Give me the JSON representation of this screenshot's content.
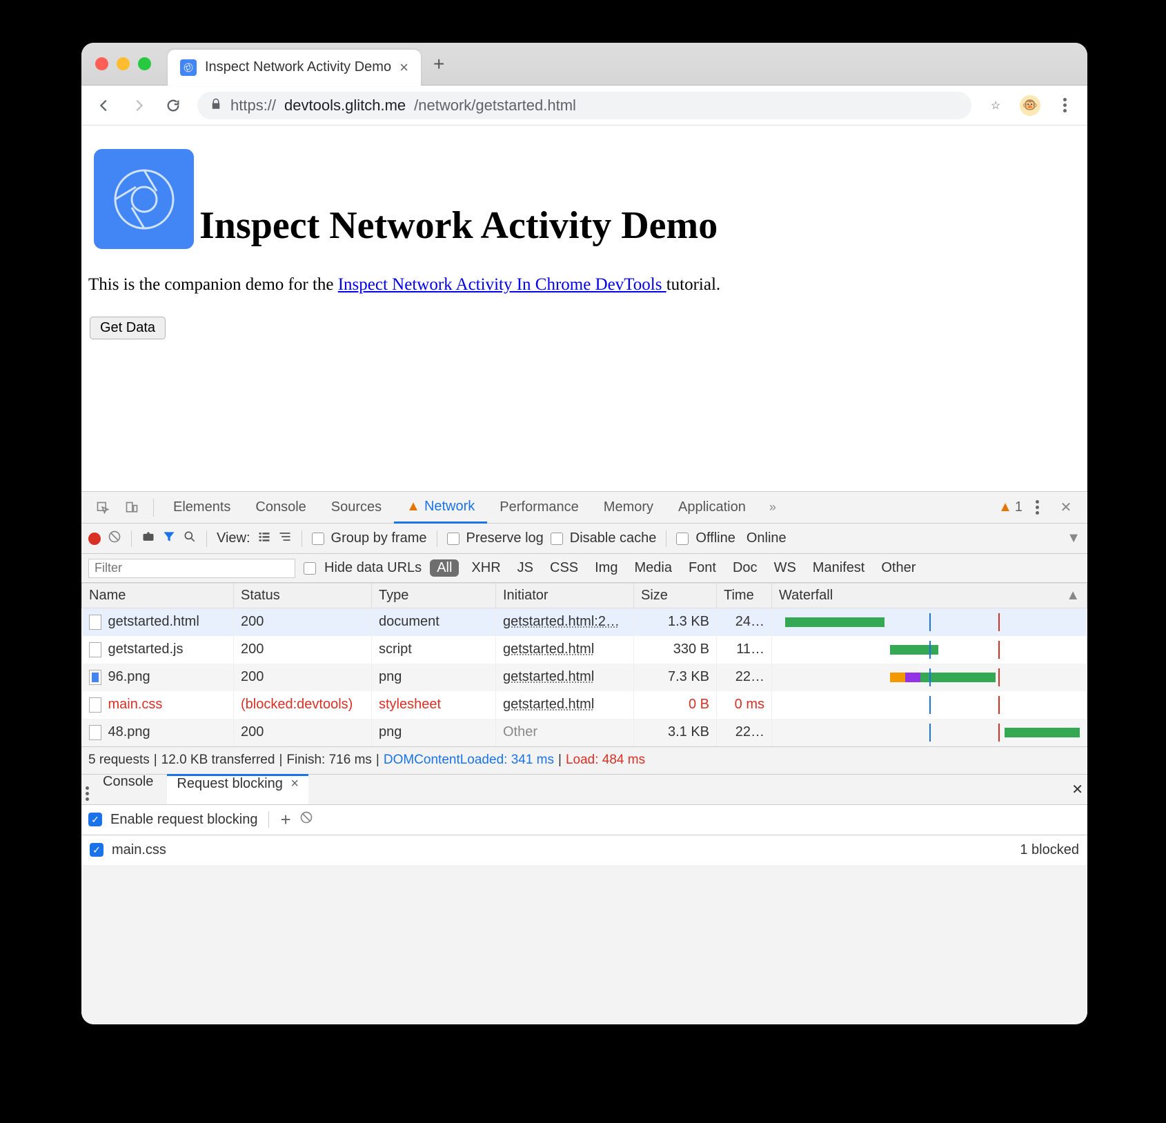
{
  "browser": {
    "tab_title": "Inspect Network Activity Demo",
    "url_display_scheme": "https://",
    "url_display_host": "devtools.glitch.me",
    "url_display_path": "/network/getstarted.html"
  },
  "page": {
    "heading": "Inspect Network Activity Demo",
    "intro_pre": "This is the companion demo for the ",
    "intro_link": "Inspect Network Activity In Chrome DevTools ",
    "intro_post": "tutorial.",
    "button": "Get Data"
  },
  "devtools": {
    "tabs": [
      "Elements",
      "Console",
      "Sources",
      "Network",
      "Performance",
      "Memory",
      "Application"
    ],
    "active_tab": "Network",
    "warning_count": "1",
    "toolbar": {
      "view_label": "View:",
      "group_by_frame": "Group by frame",
      "preserve_log": "Preserve log",
      "disable_cache": "Disable cache",
      "offline": "Offline",
      "online": "Online"
    },
    "filter": {
      "placeholder": "Filter",
      "hide_data_urls": "Hide data URLs",
      "types": [
        "All",
        "XHR",
        "JS",
        "CSS",
        "Img",
        "Media",
        "Font",
        "Doc",
        "WS",
        "Manifest",
        "Other"
      ]
    },
    "columns": [
      "Name",
      "Status",
      "Type",
      "Initiator",
      "Size",
      "Time",
      "Waterfall"
    ],
    "rows": [
      {
        "name": "getstarted.html",
        "status": "200",
        "type": "document",
        "initiator": "getstarted.html:2…",
        "size": "1.3 KB",
        "time": "24…",
        "blocked": false,
        "selected": true,
        "icon": "doc"
      },
      {
        "name": "getstarted.js",
        "status": "200",
        "type": "script",
        "initiator": "getstarted.html",
        "size": "330 B",
        "time": "11…",
        "blocked": false,
        "selected": false,
        "icon": "doc"
      },
      {
        "name": "96.png",
        "status": "200",
        "type": "png",
        "initiator": "getstarted.html",
        "size": "7.3 KB",
        "time": "22…",
        "blocked": false,
        "selected": false,
        "icon": "img"
      },
      {
        "name": "main.css",
        "status": "(blocked:devtools)",
        "type": "stylesheet",
        "initiator": "getstarted.html",
        "size": "0 B",
        "time": "0 ms",
        "blocked": true,
        "selected": false,
        "icon": "doc"
      },
      {
        "name": "48.png",
        "status": "200",
        "type": "png",
        "initiator": "Other",
        "size": "3.1 KB",
        "time": "22…",
        "blocked": false,
        "selected": false,
        "icon": "doc"
      }
    ],
    "summary": {
      "requests": "5 requests",
      "transferred": "12.0 KB transferred",
      "finish": "Finish: 716 ms",
      "dcl": "DOMContentLoaded: 341 ms",
      "load": "Load: 484 ms"
    },
    "drawer": {
      "tabs": [
        "Console",
        "Request blocking"
      ],
      "active": "Request blocking",
      "enable_label": "Enable request blocking",
      "pattern": "main.css",
      "blocked_count": "1 blocked"
    }
  }
}
